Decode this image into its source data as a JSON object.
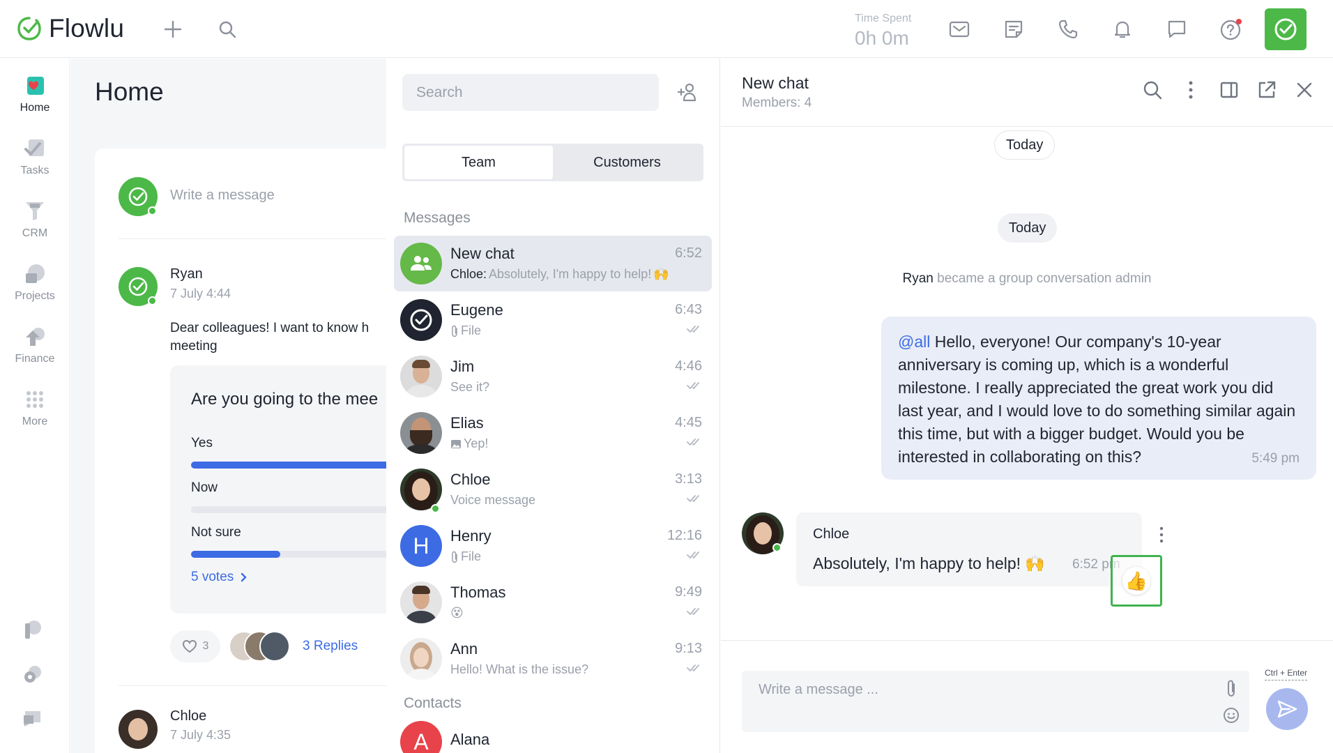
{
  "app": {
    "name": "Flowlu"
  },
  "topbar": {
    "time_spent_label": "Time Spent",
    "time_spent_value": "0h 0m",
    "icons": [
      "plus-icon",
      "search-icon",
      "mail-icon",
      "notes-icon",
      "phone-icon",
      "bell-icon",
      "chat-icon",
      "help-icon"
    ]
  },
  "leftnav": {
    "items": [
      {
        "label": "Home",
        "icon": "home-icon"
      },
      {
        "label": "Tasks",
        "icon": "tasks-icon"
      },
      {
        "label": "CRM",
        "icon": "crm-icon"
      },
      {
        "label": "Projects",
        "icon": "projects-icon"
      },
      {
        "label": "Finance",
        "icon": "finance-icon"
      },
      {
        "label": "More",
        "icon": "more-grid-icon"
      }
    ]
  },
  "home": {
    "title": "Home",
    "write_placeholder": "Write a message",
    "post1": {
      "author": "Ryan",
      "date": "7 July 4:44",
      "text_line1": "Dear colleagues! I want to know h",
      "text_line2": "meeting",
      "poll": {
        "question": "Are you going to the mee",
        "options": [
          {
            "label": "Yes",
            "share": 1.0
          },
          {
            "label": "Now",
            "share": 0.0
          },
          {
            "label": "Not sure",
            "share": 0.4
          }
        ],
        "votes": "5 votes"
      },
      "likes": "3",
      "replies": "3 Replies"
    },
    "post2": {
      "author": "Chloe",
      "date": "7 July 4:35"
    }
  },
  "chatlist": {
    "search_placeholder": "Search",
    "tabs": [
      {
        "label": "Team"
      },
      {
        "label": "Customers"
      }
    ],
    "messages_heading": "Messages",
    "contacts_heading": "Contacts",
    "chats": [
      {
        "name": "New chat",
        "sender": "Chloe:",
        "preview": "Absolutely, I'm happy to help!",
        "emoji": "🙌",
        "time": "6:52"
      },
      {
        "name": "Eugene",
        "preview": "File",
        "time": "6:43"
      },
      {
        "name": "Jim",
        "preview": "See it?",
        "time": "4:46"
      },
      {
        "name": "Elias",
        "preview": "Yep!",
        "time": "4:45"
      },
      {
        "name": "Chloe",
        "preview": "Voice message",
        "time": "3:13"
      },
      {
        "name": "Henry",
        "initial": "H",
        "preview": "File",
        "time": "12:16"
      },
      {
        "name": "Thomas",
        "emoji": "😵",
        "time": "9:49"
      },
      {
        "name": "Ann",
        "preview": "Hello! What is the issue?",
        "time": "9:13"
      }
    ],
    "contacts": [
      {
        "name": "Alana",
        "initial": "A"
      }
    ]
  },
  "chat": {
    "title": "New chat",
    "members": "Members: 4",
    "day1": "Today",
    "day2": "Today",
    "system_actor": "Ryan",
    "system_text": "became a group conversation admin",
    "outgoing": {
      "mention": "@all",
      "text": "Hello, everyone! Our company's 10-year anniversary is coming up, which is a wonderful milestone. I really appreciated the great work you did last year, and I would love to do something similar again this time, but with a bigger budget. Would you be interested in collaborating on this?",
      "time": "5:49 pm"
    },
    "incoming": {
      "author": "Chloe",
      "text": "Absolutely, I'm happy to help!",
      "emoji": "🙌",
      "time": "6:52 pm",
      "reaction": "👍"
    },
    "composer_placeholder": "Write a message ...",
    "send_hint": "Ctrl + Enter"
  },
  "colors": {
    "brand_green": "#4cb848",
    "accent_blue": "#3c6be4",
    "send_button": "#a8b8ef"
  }
}
